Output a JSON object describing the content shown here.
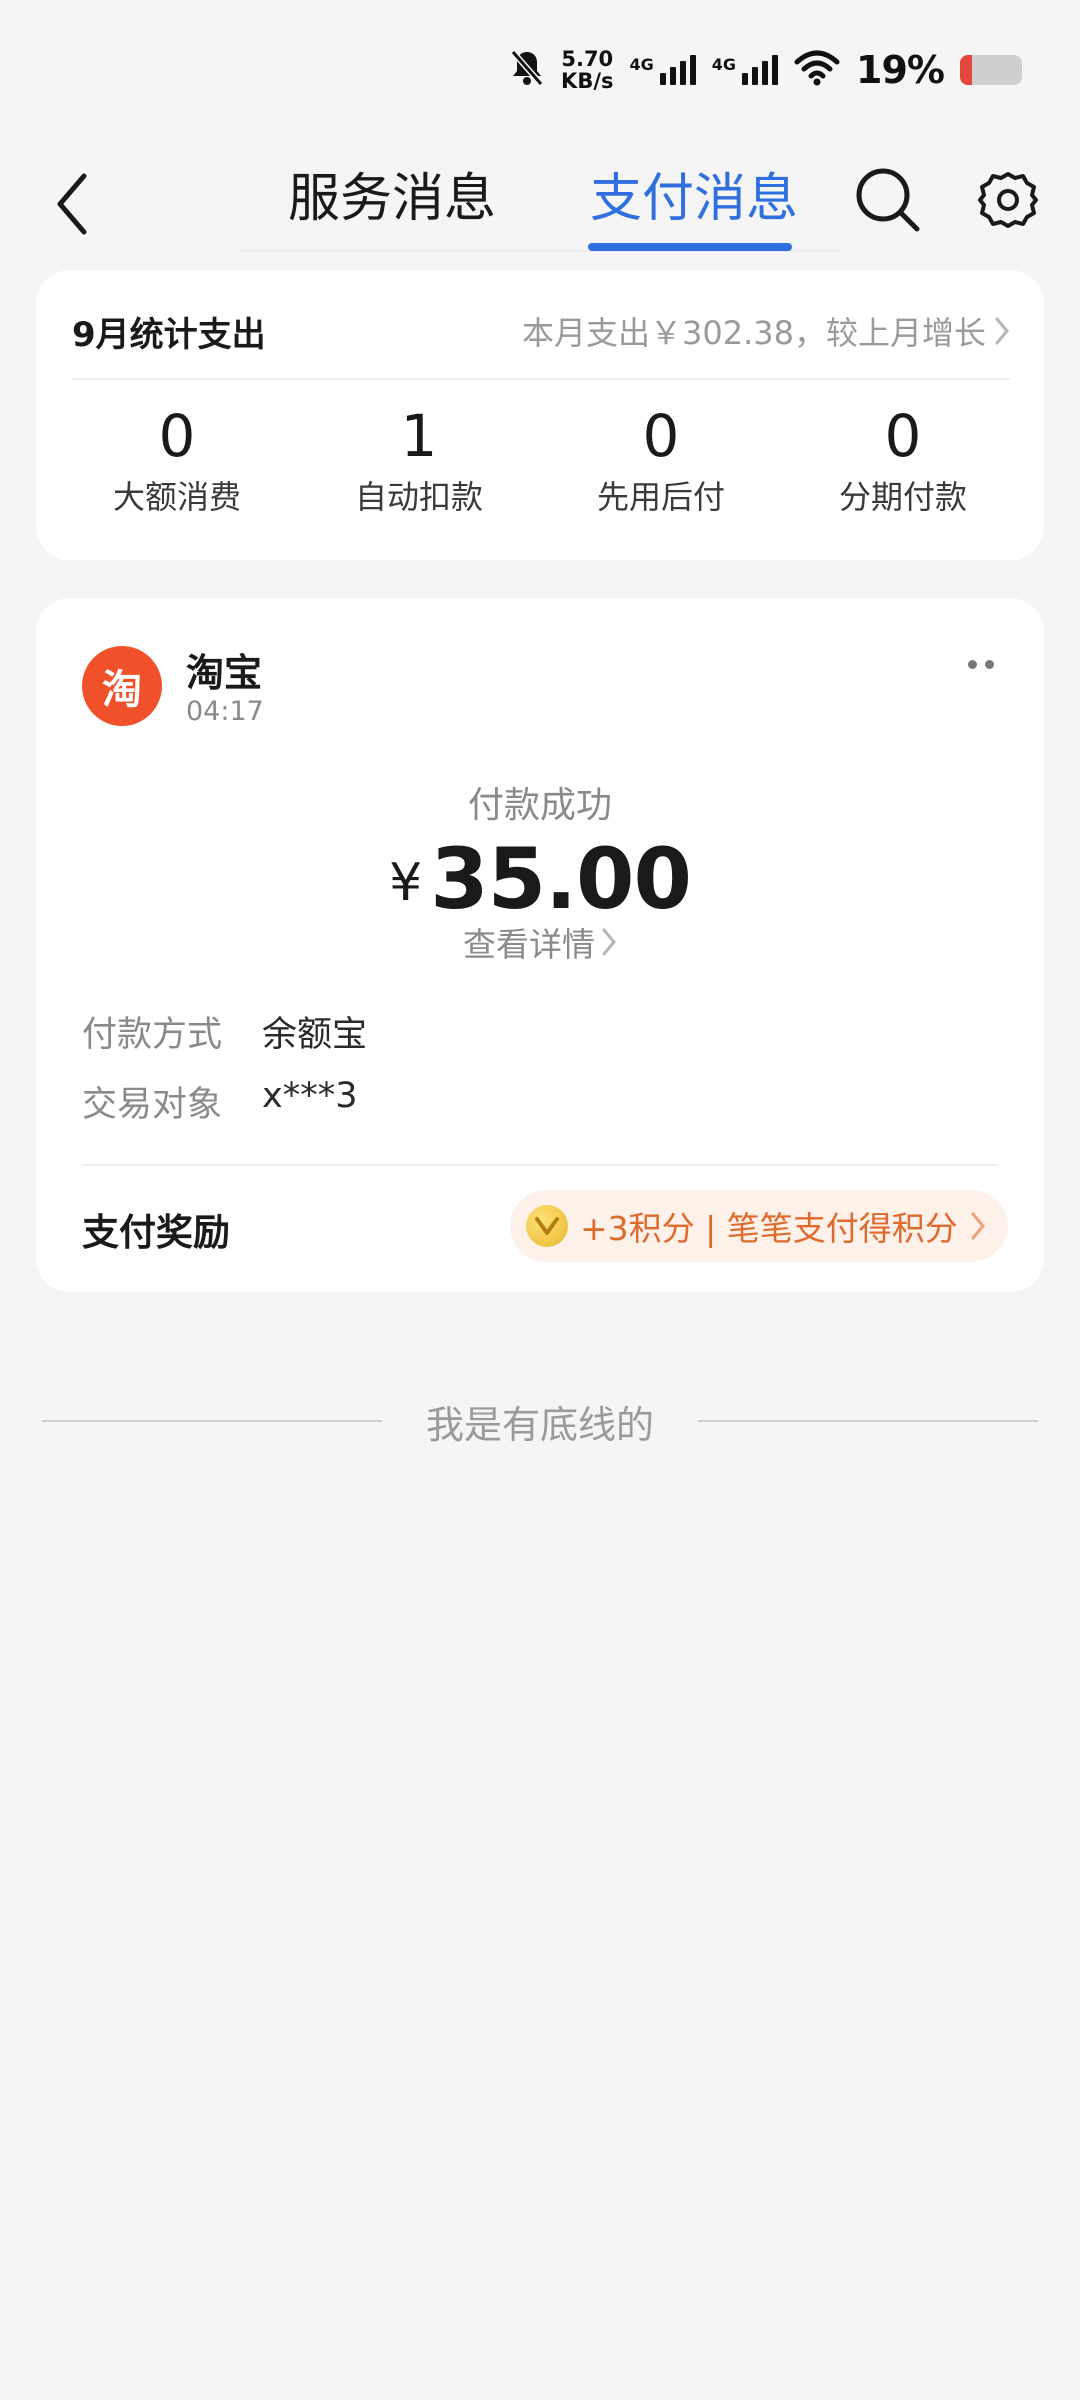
{
  "status_bar": {
    "net_speed_value": "5.70",
    "net_speed_unit": "KB/s",
    "signal1_label": "4G",
    "signal2_label": "4G",
    "battery_percent": "19%",
    "battery_level": 0.19,
    "icons": [
      "bell-off-icon",
      "signal-icon",
      "signal-icon",
      "wifi-icon",
      "battery-icon"
    ]
  },
  "header": {
    "tabs": [
      {
        "label": "服务消息",
        "active": false
      },
      {
        "label": "支付消息",
        "active": true
      }
    ],
    "accent_color": "#2f6fe0"
  },
  "summary": {
    "title": "9月统计支出",
    "link_text": "本月支出￥302.38，较上月增长",
    "stats": [
      {
        "value": "0",
        "label": "大额消费"
      },
      {
        "value": "1",
        "label": "自动扣款"
      },
      {
        "value": "0",
        "label": "先用后付"
      },
      {
        "value": "0",
        "label": "分期付款"
      }
    ]
  },
  "payment": {
    "merchant_logo_text": "淘",
    "merchant_name": "淘宝",
    "time": "04:17",
    "status": "付款成功",
    "currency": "¥",
    "amount": "35.00",
    "detail_link": "查看详情",
    "info": [
      {
        "key": "付款方式",
        "value": "余额宝"
      },
      {
        "key": "交易对象",
        "value": "x***3"
      }
    ],
    "reward_label": "支付奖励",
    "reward_text": "+3积分 | 笔笔支付得积分",
    "brand_color": "#f0512a"
  },
  "footer": {
    "end_text": "我是有底线的"
  }
}
